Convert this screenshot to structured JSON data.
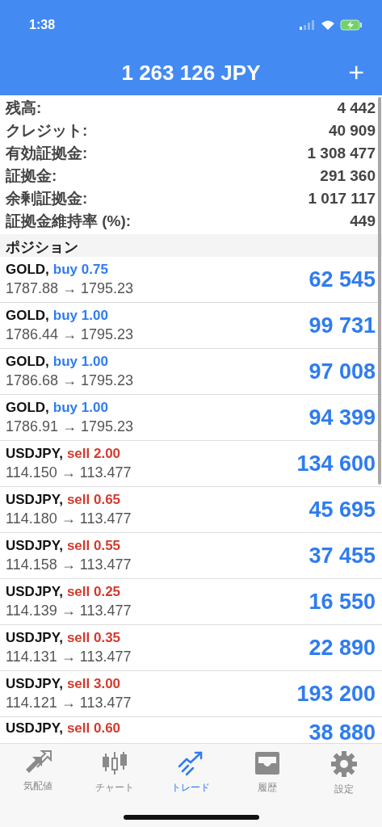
{
  "status_bar": {
    "time": "1:38"
  },
  "header": {
    "title": "1 263 126 JPY",
    "add": "+"
  },
  "summary": [
    {
      "label": "残高:",
      "value": "4 442"
    },
    {
      "label": "クレジット:",
      "value": "40 909"
    },
    {
      "label": "有効証拠金:",
      "value": "1 308 477"
    },
    {
      "label": "証拠金:",
      "value": "291 360"
    },
    {
      "label": "余剰証拠金:",
      "value": "1 017 117"
    },
    {
      "label": "証拠金維持率 (%):",
      "value": "449"
    }
  ],
  "section_title": "ポジション",
  "positions": [
    {
      "symbol": "GOLD,",
      "kind": "buy",
      "order": "buy 0.75",
      "prices": "1787.88 → 1795.23",
      "profit": "62 545"
    },
    {
      "symbol": "GOLD,",
      "kind": "buy",
      "order": "buy 1.00",
      "prices": "1786.44 → 1795.23",
      "profit": "99 731"
    },
    {
      "symbol": "GOLD,",
      "kind": "buy",
      "order": "buy 1.00",
      "prices": "1786.68 → 1795.23",
      "profit": "97 008"
    },
    {
      "symbol": "GOLD,",
      "kind": "buy",
      "order": "buy 1.00",
      "prices": "1786.91 → 1795.23",
      "profit": "94 399"
    },
    {
      "symbol": "USDJPY,",
      "kind": "sell",
      "order": "sell 2.00",
      "prices": "114.150 → 113.477",
      "profit": "134 600"
    },
    {
      "symbol": "USDJPY,",
      "kind": "sell",
      "order": "sell 0.65",
      "prices": "114.180 → 113.477",
      "profit": "45 695"
    },
    {
      "symbol": "USDJPY,",
      "kind": "sell",
      "order": "sell 0.55",
      "prices": "114.158 → 113.477",
      "profit": "37 455"
    },
    {
      "symbol": "USDJPY,",
      "kind": "sell",
      "order": "sell 0.25",
      "prices": "114.139 → 113.477",
      "profit": "16 550"
    },
    {
      "symbol": "USDJPY,",
      "kind": "sell",
      "order": "sell 0.35",
      "prices": "114.131 → 113.477",
      "profit": "22 890"
    },
    {
      "symbol": "USDJPY,",
      "kind": "sell",
      "order": "sell 3.00",
      "prices": "114.121 → 113.477",
      "profit": "193 200"
    },
    {
      "symbol": "USDJPY,",
      "kind": "sell",
      "order": "sell 0.60",
      "profit": "38 880"
    }
  ],
  "tabs": [
    {
      "label": "気配値",
      "kind": "quotes",
      "selected": false
    },
    {
      "label": "チャート",
      "kind": "chart",
      "selected": false
    },
    {
      "label": "トレード",
      "kind": "trade",
      "selected": true
    },
    {
      "label": "履歴",
      "kind": "history",
      "selected": false
    },
    {
      "label": "設定",
      "kind": "settings",
      "selected": false
    }
  ]
}
